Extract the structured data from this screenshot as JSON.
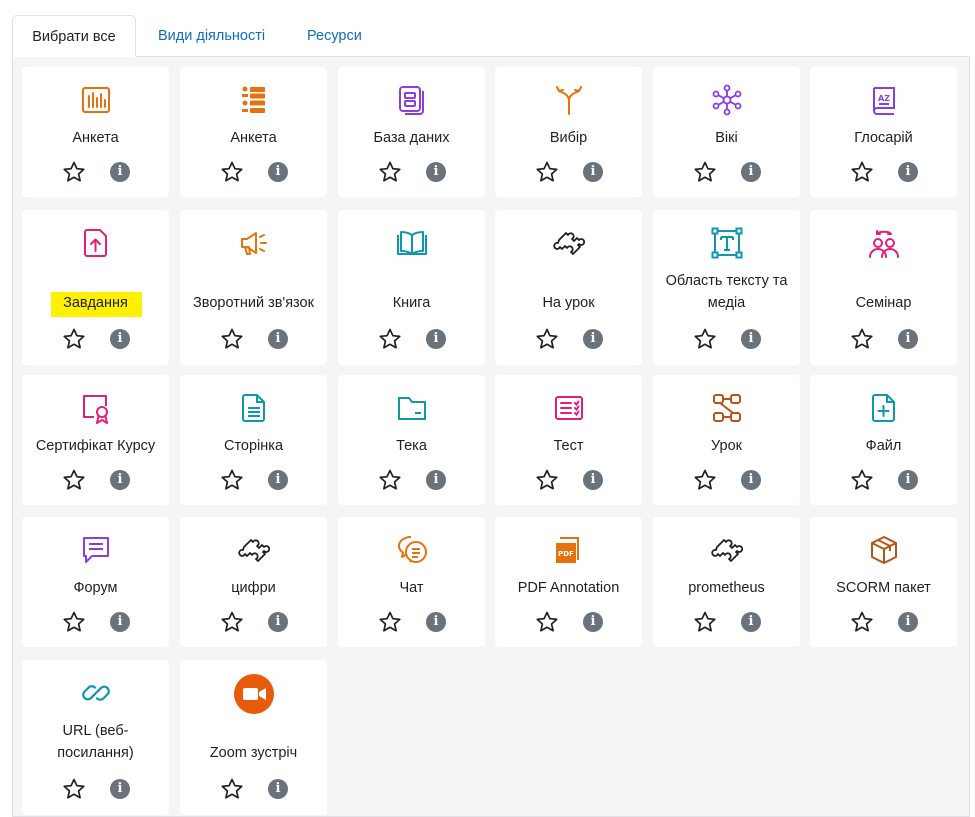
{
  "tabs": [
    {
      "label": "Вибрати все",
      "active": true
    },
    {
      "label": "Види діяльності",
      "active": false
    },
    {
      "label": "Ресурси",
      "active": false
    }
  ],
  "items": [
    {
      "name": "Анкета",
      "icon": "bar-chart-icon",
      "color": "#e6720f"
    },
    {
      "name": "Анкета",
      "icon": "checklist-icon",
      "color": "#e6720f"
    },
    {
      "name": "База даних",
      "icon": "database-icon",
      "color": "#8b3ee0"
    },
    {
      "name": "Вибір",
      "icon": "split-arrows-icon",
      "color": "#e6720f"
    },
    {
      "name": "Вікі",
      "icon": "network-icon",
      "color": "#8b3ee0"
    },
    {
      "name": "Глосарій",
      "icon": "glossary-book-icon",
      "color": "#8b3ee0"
    },
    {
      "name": "Завдання",
      "icon": "upload-file-icon",
      "color": "#e2207c"
    },
    {
      "name": "Зворотний зв'язок",
      "icon": "megaphone-icon",
      "color": "#e6720f"
    },
    {
      "name": "Книга",
      "icon": "open-book-icon",
      "color": "#0d98ac"
    },
    {
      "name": "На урок",
      "icon": "puzzle-icon",
      "color": "#1d2125"
    },
    {
      "name": "Область тексту та медіа",
      "icon": "text-frame-icon",
      "color": "#0d98ac"
    },
    {
      "name": "Семінар",
      "icon": "people-exchange-icon",
      "color": "#e2207c"
    },
    {
      "name": "Сертифікат Курсу",
      "icon": "certificate-icon",
      "color": "#e2207c"
    },
    {
      "name": "Сторінка",
      "icon": "page-icon",
      "color": "#0d98ac"
    },
    {
      "name": "Тека",
      "icon": "folder-icon",
      "color": "#0d98ac"
    },
    {
      "name": "Тест",
      "icon": "quiz-icon",
      "color": "#e2207c"
    },
    {
      "name": "Урок",
      "icon": "lesson-flow-icon",
      "color": "#b6541a"
    },
    {
      "name": "Файл",
      "icon": "file-plus-icon",
      "color": "#0d98ac"
    },
    {
      "name": "Форум",
      "icon": "forum-icon",
      "color": "#8b3ee0"
    },
    {
      "name": "цифри",
      "icon": "puzzle-icon",
      "color": "#1d2125"
    },
    {
      "name": "Чат",
      "icon": "chat-icon",
      "color": "#e6720f"
    },
    {
      "name": "PDF Annotation",
      "icon": "pdf-icon",
      "color": "#e6720f"
    },
    {
      "name": "prometheus",
      "icon": "puzzle-icon",
      "color": "#1d2125"
    },
    {
      "name": "SCORM пакет",
      "icon": "package-box-icon",
      "color": "#b6541a"
    },
    {
      "name": "URL (веб-посилання)",
      "icon": "link-icon",
      "color": "#0d98ac"
    },
    {
      "name": "Zoom зустріч",
      "icon": "zoom-camera-icon",
      "color": "#e65a0a"
    }
  ],
  "highlighted_item": "Завдання",
  "highlight_color": "#fff000",
  "info_icon_color": "#6a737b",
  "link_color": "#0f6cbf"
}
